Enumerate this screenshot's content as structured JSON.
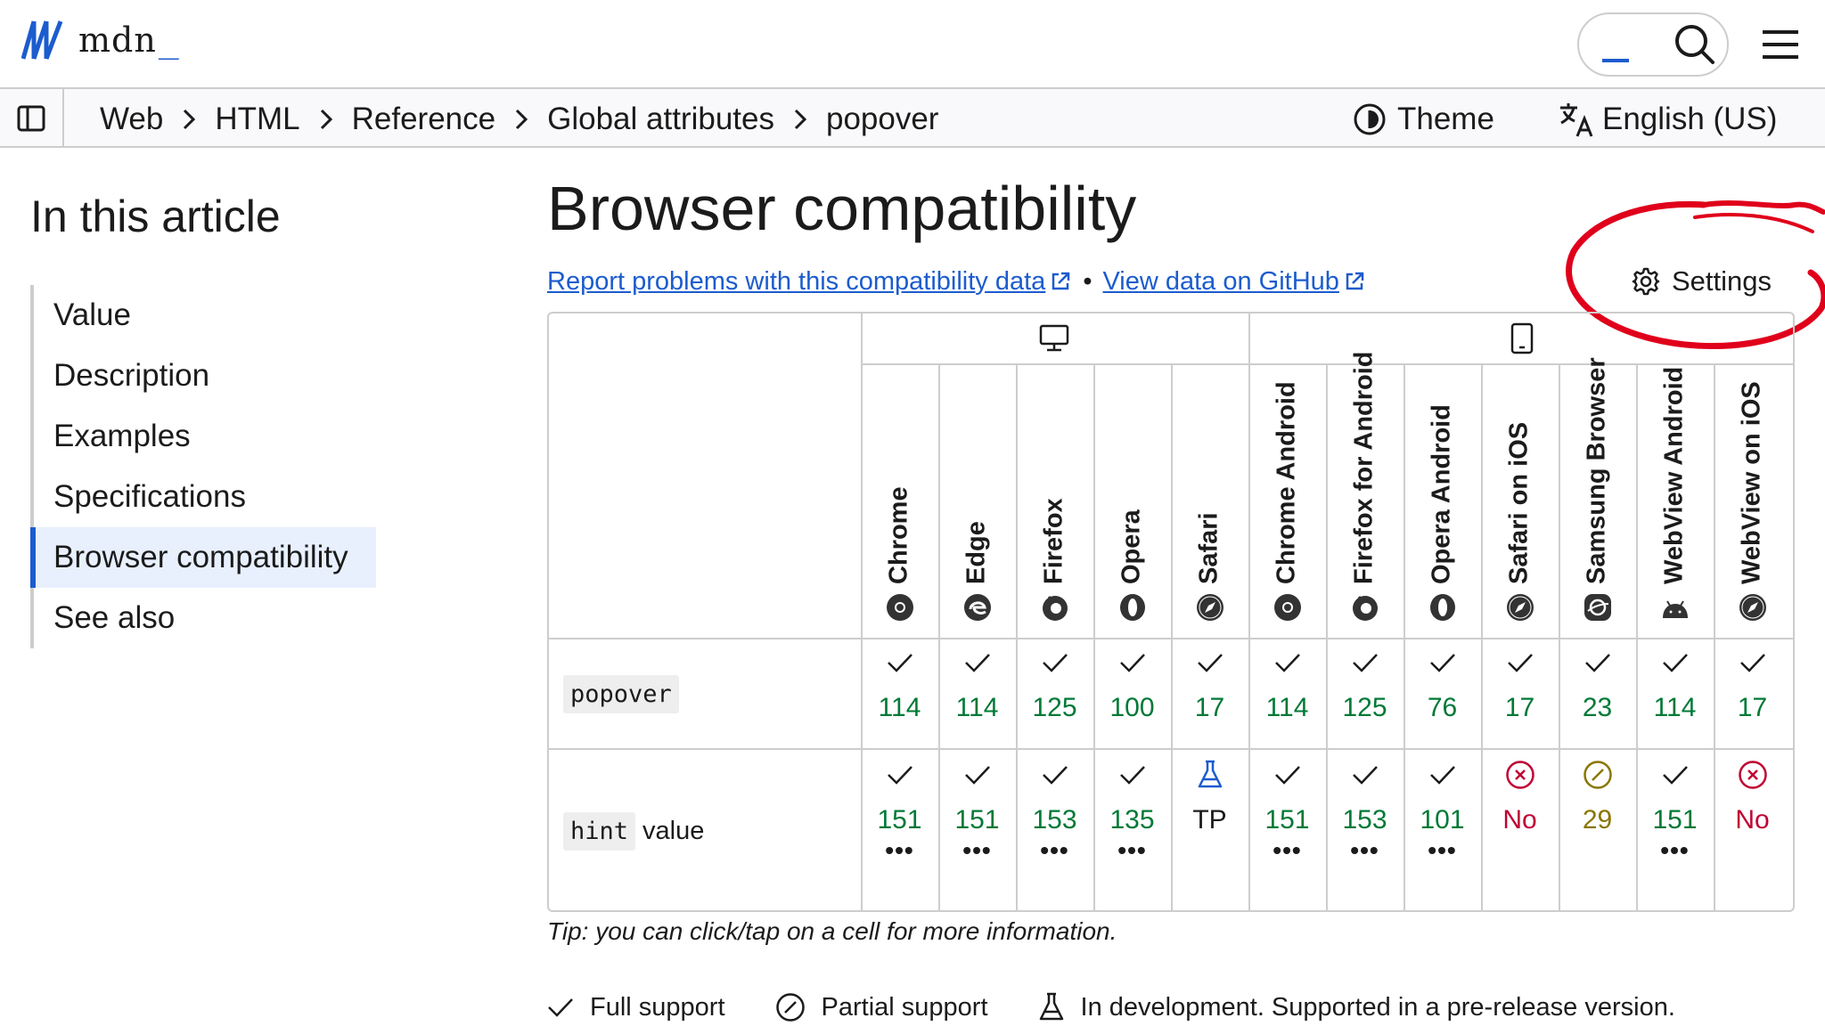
{
  "header": {
    "logo_text": "mdn",
    "logo_underscore": "_"
  },
  "breadcrumb": {
    "items": [
      "Web",
      "HTML",
      "Reference",
      "Global attributes",
      "popover"
    ]
  },
  "toolbar": {
    "theme_label": "Theme",
    "language_label": "English (US)"
  },
  "toc": {
    "title": "In this article",
    "items": [
      "Value",
      "Description",
      "Examples",
      "Specifications",
      "Browser compatibility",
      "See also"
    ],
    "active": "Browser compatibility"
  },
  "main": {
    "title": "Browser compatibility",
    "report_link": "Report problems with this compatibility data",
    "separator": "•",
    "github_link": "View data on GitHub",
    "settings_label": "Settings",
    "tip": "Tip: you can click/tap on a cell for more information."
  },
  "table": {
    "groups": [
      "desktop-icon",
      "mobile-icon"
    ],
    "browsers": [
      "Chrome",
      "Edge",
      "Firefox",
      "Opera",
      "Safari",
      "Chrome Android",
      "Firefox for Android",
      "Opera Android",
      "Safari on iOS",
      "Samsung Browser",
      "WebView Android",
      "WebView on iOS"
    ],
    "rows": [
      {
        "feature_code": "popover",
        "feature_text": "",
        "cells": [
          {
            "status": "full",
            "version": "114"
          },
          {
            "status": "full",
            "version": "114"
          },
          {
            "status": "full",
            "version": "125"
          },
          {
            "status": "full",
            "version": "100"
          },
          {
            "status": "full",
            "version": "17"
          },
          {
            "status": "full",
            "version": "114"
          },
          {
            "status": "full",
            "version": "125"
          },
          {
            "status": "full",
            "version": "76"
          },
          {
            "status": "full",
            "version": "17"
          },
          {
            "status": "full",
            "version": "23"
          },
          {
            "status": "full",
            "version": "114"
          },
          {
            "status": "full",
            "version": "17"
          }
        ]
      },
      {
        "feature_code": "hint",
        "feature_text": "value",
        "cells": [
          {
            "status": "full",
            "version": "151",
            "more": "•••"
          },
          {
            "status": "full",
            "version": "151",
            "more": "•••"
          },
          {
            "status": "full",
            "version": "153",
            "more": "•••"
          },
          {
            "status": "full",
            "version": "135",
            "more": "•••"
          },
          {
            "status": "preview",
            "version": "TP"
          },
          {
            "status": "full",
            "version": "151",
            "more": "•••"
          },
          {
            "status": "full",
            "version": "153",
            "more": "•••"
          },
          {
            "status": "full",
            "version": "101",
            "more": "•••"
          },
          {
            "status": "none",
            "version": "No"
          },
          {
            "status": "partial",
            "version": "29"
          },
          {
            "status": "full",
            "version": "151",
            "more": "•••"
          },
          {
            "status": "none",
            "version": "No"
          }
        ]
      }
    ]
  },
  "legend": {
    "items": [
      {
        "icon": "check-icon",
        "label": "Full support"
      },
      {
        "icon": "partial-icon",
        "label": "Partial support"
      },
      {
        "icon": "flask-icon",
        "label": "In development. Supported in a pre-release version."
      }
    ]
  },
  "colors": {
    "accent": "#1c5cce",
    "full_support": "#007936",
    "no_support": "#c00033",
    "partial_support": "#8a7600",
    "annotation": "#e0001b"
  }
}
